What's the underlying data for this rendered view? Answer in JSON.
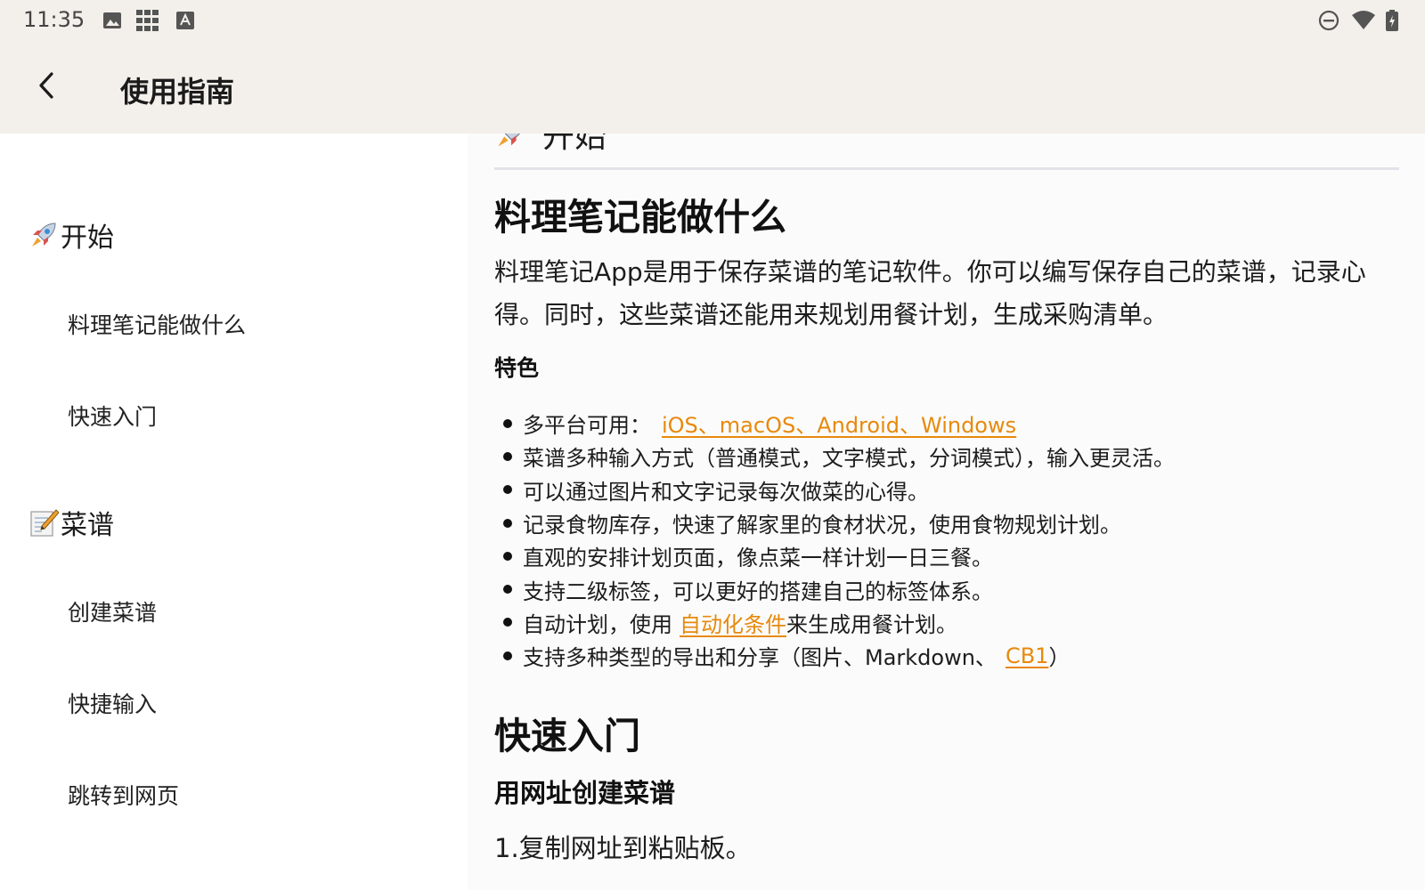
{
  "status_bar": {
    "time": "11:35",
    "left_icons": [
      "image-icon",
      "grid-icon",
      "text-a-icon"
    ],
    "right_icons": [
      "do-not-disturb-icon",
      "wifi-icon",
      "battery-icon"
    ]
  },
  "app_bar": {
    "back_icon": "chevron-left-icon",
    "title": "使用指南"
  },
  "sidebar": {
    "sections": [
      {
        "icon": "rocket-icon",
        "label": "开始",
        "items": [
          "料理笔记能做什么",
          "快速入门"
        ]
      },
      {
        "icon": "memo-icon",
        "label": "菜谱",
        "items": [
          "创建菜谱",
          "快捷输入",
          "跳转到网页"
        ]
      }
    ]
  },
  "content": {
    "top_heading_partial": "开始",
    "section1": {
      "title": "料理笔记能做什么",
      "paragraph": "料理笔记App是用于保存菜谱的笔记软件。你可以编写保存自己的菜谱，记录心得。同时，这些菜谱还能用来规划用餐计划，生成采购清单。",
      "features_title": "特色",
      "features": {
        "f1_prefix": "多平台可用：",
        "f1_link": "iOS、macOS、Android、Windows",
        "f2": "菜谱多种输入方式（普通模式，文字模式，分词模式），输入更灵活。",
        "f3": "可以通过图片和文字记录每次做菜的心得。",
        "f4": "记录食物库存，快速了解家里的食材状况，使用食物规划计划。",
        "f5": "直观的安排计划页面，像点菜一样计划一日三餐。",
        "f6": "支持二级标签，可以更好的搭建自己的标签体系。",
        "f7_prefix": "自动计划，使用",
        "f7_link": "自动化条件",
        "f7_suffix": "来生成用餐计划。",
        "f8_prefix": "支持多种类型的导出和分享（图片、Markdown、",
        "f8_link": "CB1",
        "f8_suffix": "）"
      }
    },
    "section2": {
      "title": "快速入门",
      "subtitle": "用网址创建菜谱",
      "step1": "1.复制网址到粘贴板。"
    }
  },
  "colors": {
    "bar_background": "#f3efea",
    "link": "#e8890c",
    "divider": "#e2e2ea"
  }
}
